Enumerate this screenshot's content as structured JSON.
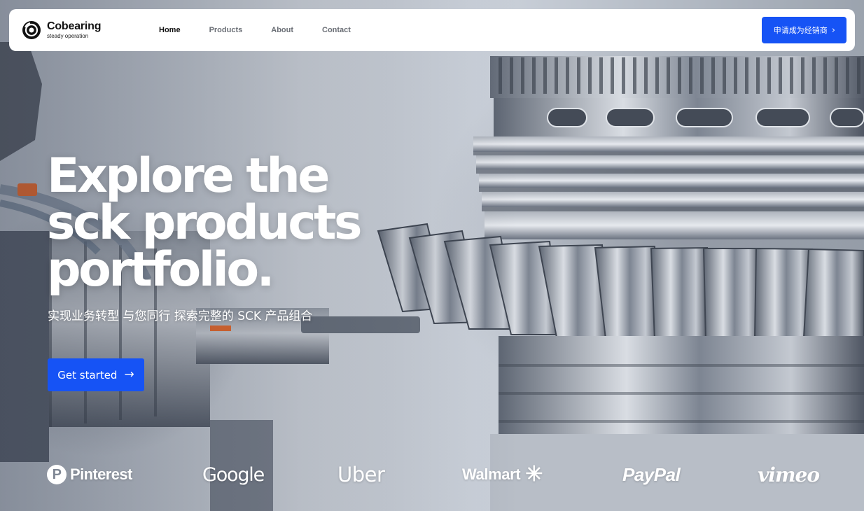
{
  "header": {
    "logo_name": "Cobearing",
    "logo_tagline": "steady operation",
    "nav": [
      {
        "label": "Home",
        "active": true
      },
      {
        "label": "Products",
        "active": false
      },
      {
        "label": "About",
        "active": false
      },
      {
        "label": "Contact",
        "active": false
      }
    ],
    "cta_label": "申请成为经销商",
    "cta_icon": "chevron-right-icon"
  },
  "hero": {
    "title_lines": [
      "Explore the",
      "sck products",
      "portfolio."
    ],
    "subtitle": "实现业务转型 与您同行 探索完整的 SCK 产品组合",
    "cta_label": "Get started",
    "cta_icon": "arrow-right-icon"
  },
  "brands": [
    {
      "name": "Pinterest",
      "icon": "pinterest-icon"
    },
    {
      "name": "Google"
    },
    {
      "name": "Uber"
    },
    {
      "name": "Walmart",
      "icon": "walmart-spark-icon"
    },
    {
      "name": "PayPal"
    },
    {
      "name": "vimeo"
    }
  ],
  "colors": {
    "accent": "#1653f5",
    "nav_active": "#111111",
    "nav_inactive": "#6b6f76",
    "header_bg": "#ffffff"
  }
}
